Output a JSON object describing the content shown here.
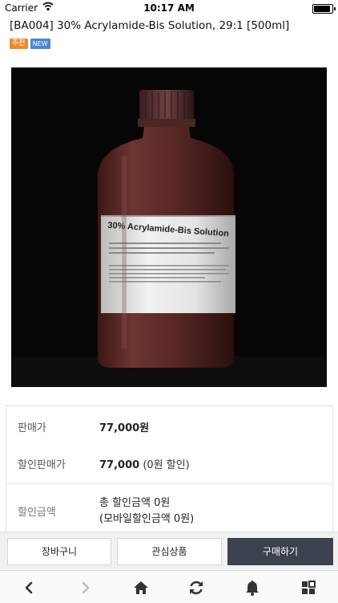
{
  "status_bar": {
    "carrier": "Carrier",
    "time": "10:17 AM",
    "battery_level": 1.0
  },
  "product": {
    "title": "[BA004] 30% Acrylamide-Bis Solution, 29:1 [500ml]",
    "badges": [
      {
        "label": "추천",
        "color": "#ee8a2e"
      },
      {
        "label": "NEW",
        "color": "#4a86d8"
      }
    ],
    "image_label_text": "30% Acrylamide-Bis Solution"
  },
  "price_info": {
    "sale_price_label": "판매가",
    "sale_price_value": "77,000원",
    "discount_price_label": "할인판매가",
    "discount_price_value": "77,000",
    "discount_price_note": "(0원 할인)",
    "discount_amount_label": "할인금액",
    "discount_total_line": "총 할인금액 0원",
    "discount_mobile_line": "(모바일할인금액 0원)"
  },
  "actions": {
    "cart_label": "장바구니",
    "wishlist_label": "관심상품",
    "buy_label": "구매하기"
  },
  "bottom_nav": {
    "icons": [
      "back-icon",
      "forward-icon",
      "home-icon",
      "refresh-icon",
      "bell-icon",
      "apps-icon"
    ]
  },
  "colors": {
    "buy_button": "#3c424f",
    "recommend_badge": "#ee8a2e",
    "new_badge": "#4a86d8"
  }
}
